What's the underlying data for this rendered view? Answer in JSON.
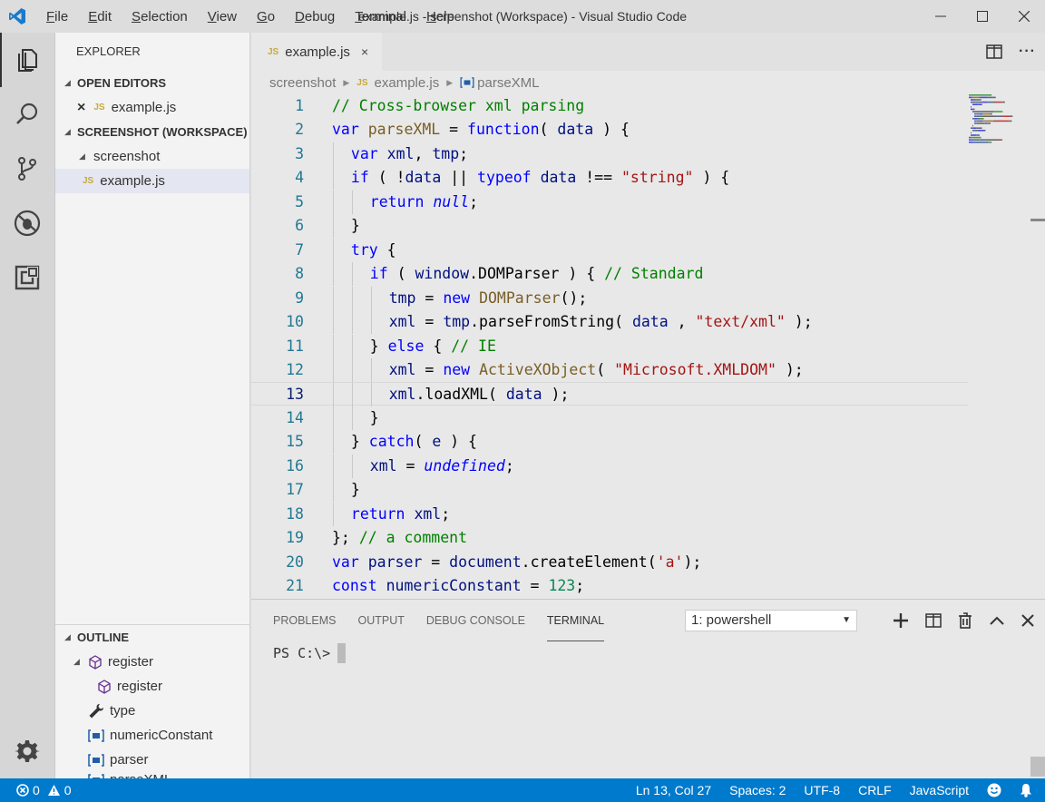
{
  "window": {
    "title": "example.js - screenshot (Workspace) - Visual Studio Code"
  },
  "menu": [
    {
      "label": "File",
      "mnemonic": "F",
      "rest": "ile"
    },
    {
      "label": "Edit",
      "mnemonic": "E",
      "rest": "dit"
    },
    {
      "label": "Selection",
      "mnemonic": "S",
      "rest": "election"
    },
    {
      "label": "View",
      "mnemonic": "V",
      "rest": "iew"
    },
    {
      "label": "Go",
      "mnemonic": "G",
      "rest": "o"
    },
    {
      "label": "Debug",
      "mnemonic": "D",
      "rest": "ebug"
    },
    {
      "label": "Terminal",
      "mnemonic": "T",
      "rest": "erminal"
    },
    {
      "label": "Help",
      "mnemonic": "H",
      "rest": "elp"
    }
  ],
  "sidebar": {
    "title": "EXPLORER",
    "open_editors": {
      "header": "OPEN EDITORS",
      "items": [
        {
          "badge": "JS",
          "label": "example.js"
        }
      ]
    },
    "workspace": {
      "header": "SCREENSHOT (WORKSPACE)",
      "folder": "screenshot",
      "file_badge": "JS",
      "file": "example.js"
    },
    "outline": {
      "header": "OUTLINE",
      "items": [
        {
          "label": "register",
          "icon": "cube-icon"
        },
        {
          "label": "register",
          "icon": "cube-icon"
        },
        {
          "label": "type",
          "icon": "wrench-icon"
        },
        {
          "label": "numericConstant",
          "icon": "variable-icon"
        },
        {
          "label": "parser",
          "icon": "variable-icon"
        },
        {
          "label": "parseXML",
          "icon": "variable-icon"
        }
      ]
    }
  },
  "editor": {
    "tab": {
      "badge": "JS",
      "label": "example.js",
      "close": "×"
    },
    "breadcrumb": {
      "folder": "screenshot",
      "file_badge": "JS",
      "file": "example.js",
      "symbol": "parseXML"
    },
    "current_line": 13,
    "lines": [
      {
        "n": "1",
        "indent": 0,
        "tokens": [
          [
            "c-com",
            "// Cross-browser xml parsing"
          ]
        ]
      },
      {
        "n": "2",
        "indent": 0,
        "tokens": [
          [
            "c-kw",
            "var "
          ],
          [
            "c-fn",
            "parseXML"
          ],
          [
            "c-plain",
            " = "
          ],
          [
            "c-kw",
            "function"
          ],
          [
            "c-plain",
            "( "
          ],
          [
            "c-var",
            "data"
          ],
          [
            "c-plain",
            " ) {"
          ]
        ]
      },
      {
        "n": "3",
        "indent": 1,
        "tokens": [
          [
            "c-kw",
            "var "
          ],
          [
            "c-var",
            "xml"
          ],
          [
            "c-plain",
            ", "
          ],
          [
            "c-var",
            "tmp"
          ],
          [
            "c-plain",
            ";"
          ]
        ]
      },
      {
        "n": "4",
        "indent": 1,
        "tokens": [
          [
            "c-kw",
            "if"
          ],
          [
            "c-plain",
            " ( !"
          ],
          [
            "c-var",
            "data"
          ],
          [
            "c-plain",
            " || "
          ],
          [
            "c-kw",
            "typeof "
          ],
          [
            "c-var",
            "data"
          ],
          [
            "c-plain",
            " !== "
          ],
          [
            "c-str",
            "\"string\""
          ],
          [
            "c-plain",
            " ) {"
          ]
        ]
      },
      {
        "n": "5",
        "indent": 2,
        "tokens": [
          [
            "c-kw",
            "return "
          ],
          [
            "c-kw",
            "null"
          ],
          [
            "c-plain",
            ";"
          ]
        ]
      },
      {
        "n": "6",
        "indent": 1,
        "tokens": [
          [
            "c-plain",
            "}"
          ]
        ]
      },
      {
        "n": "7",
        "indent": 1,
        "tokens": [
          [
            "c-kw",
            "try"
          ],
          [
            "c-plain",
            " {"
          ]
        ]
      },
      {
        "n": "8",
        "indent": 2,
        "tokens": [
          [
            "c-kw",
            "if"
          ],
          [
            "c-plain",
            " ( "
          ],
          [
            "c-var",
            "window"
          ],
          [
            "c-plain",
            ".DOMParser ) { "
          ],
          [
            "c-com",
            "// Standard"
          ]
        ]
      },
      {
        "n": "9",
        "indent": 3,
        "tokens": [
          [
            "c-var",
            "tmp"
          ],
          [
            "c-plain",
            " = "
          ],
          [
            "c-kw",
            "new "
          ],
          [
            "c-fn",
            "DOMParser"
          ],
          [
            "c-plain",
            "();"
          ]
        ]
      },
      {
        "n": "10",
        "indent": 3,
        "tokens": [
          [
            "c-var",
            "xml"
          ],
          [
            "c-plain",
            " = "
          ],
          [
            "c-var",
            "tmp"
          ],
          [
            "c-plain",
            ".parseFromString( "
          ],
          [
            "c-var",
            "data"
          ],
          [
            "c-plain",
            " , "
          ],
          [
            "c-str",
            "\"text/xml\""
          ],
          [
            "c-plain",
            " );"
          ]
        ]
      },
      {
        "n": "11",
        "indent": 2,
        "tokens": [
          [
            "c-plain",
            "} "
          ],
          [
            "c-kw",
            "else"
          ],
          [
            "c-plain",
            " { "
          ],
          [
            "c-com",
            "// IE"
          ]
        ]
      },
      {
        "n": "12",
        "indent": 3,
        "tokens": [
          [
            "c-var",
            "xml"
          ],
          [
            "c-plain",
            " = "
          ],
          [
            "c-kw",
            "new "
          ],
          [
            "c-fn",
            "ActiveXObject"
          ],
          [
            "c-plain",
            "( "
          ],
          [
            "c-str",
            "\"Microsoft.XMLDOM\""
          ],
          [
            "c-plain",
            " );"
          ]
        ]
      },
      {
        "n": "13",
        "indent": 3,
        "tokens": [
          [
            "c-var",
            "xml"
          ],
          [
            "c-plain",
            ".loadXML( "
          ],
          [
            "c-var",
            "data"
          ],
          [
            "c-plain",
            " );"
          ]
        ]
      },
      {
        "n": "14",
        "indent": 2,
        "tokens": [
          [
            "c-plain",
            "}"
          ]
        ]
      },
      {
        "n": "15",
        "indent": 1,
        "tokens": [
          [
            "c-plain",
            "} "
          ],
          [
            "c-kw",
            "catch"
          ],
          [
            "c-plain",
            "( "
          ],
          [
            "c-var",
            "e"
          ],
          [
            "c-plain",
            " ) {"
          ]
        ]
      },
      {
        "n": "16",
        "indent": 2,
        "tokens": [
          [
            "c-var",
            "xml"
          ],
          [
            "c-plain",
            " = "
          ],
          [
            "c-kw",
            "undefined"
          ],
          [
            "c-plain",
            ";"
          ]
        ]
      },
      {
        "n": "17",
        "indent": 1,
        "tokens": [
          [
            "c-plain",
            "}"
          ]
        ]
      },
      {
        "n": "18",
        "indent": 1,
        "tokens": [
          [
            "c-kw",
            "return "
          ],
          [
            "c-var",
            "xml"
          ],
          [
            "c-plain",
            ";"
          ]
        ]
      },
      {
        "n": "19",
        "indent": 0,
        "tokens": [
          [
            "c-plain",
            "}; "
          ],
          [
            "c-com",
            "// a comment"
          ]
        ]
      },
      {
        "n": "20",
        "indent": 0,
        "tokens": [
          [
            "c-kw",
            "var "
          ],
          [
            "c-var",
            "parser"
          ],
          [
            "c-plain",
            " = "
          ],
          [
            "c-var",
            "document"
          ],
          [
            "c-plain",
            ".createElement("
          ],
          [
            "c-str",
            "'a'"
          ],
          [
            "c-plain",
            ");"
          ]
        ]
      },
      {
        "n": "21",
        "indent": 0,
        "tokens": [
          [
            "c-kw",
            "const "
          ],
          [
            "c-var",
            "numericConstant"
          ],
          [
            "c-plain",
            " = "
          ],
          [
            "c-num",
            "123"
          ],
          [
            "c-plain",
            ";"
          ]
        ]
      }
    ]
  },
  "panel": {
    "tabs": [
      "PROBLEMS",
      "OUTPUT",
      "DEBUG CONSOLE",
      "TERMINAL"
    ],
    "active_tab": "TERMINAL",
    "terminal_select": "1: powershell",
    "prompt": "PS C:\\>"
  },
  "statusbar": {
    "errors": "0",
    "warnings": "0",
    "position": "Ln 13, Col 27",
    "spaces": "Spaces: 2",
    "encoding": "UTF-8",
    "eol": "CRLF",
    "language": "JavaScript"
  },
  "colors": {
    "status_bar": "#007acc",
    "activity_bar": "#d6d6d6",
    "editor_bg": "#e8e8e8",
    "sidebar_bg": "#f3f3f3"
  }
}
